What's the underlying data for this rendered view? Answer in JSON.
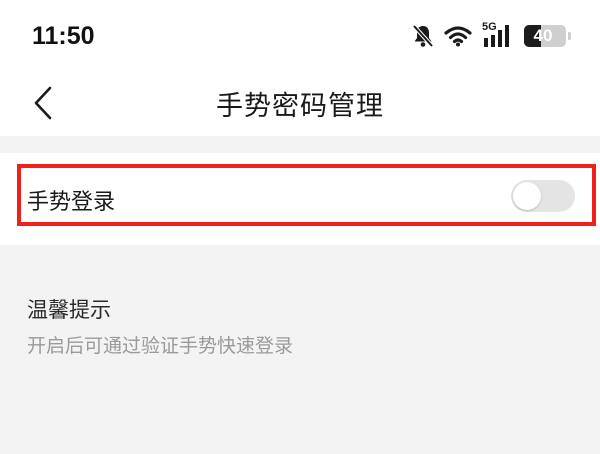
{
  "status_bar": {
    "time": "11:50",
    "network_label": "5G",
    "battery_level": "40",
    "battery_fraction": 0.4,
    "icons": [
      "bell-muted-icon",
      "wifi-icon",
      "signal-5g-icon",
      "battery-icon"
    ]
  },
  "nav": {
    "title": "手势密码管理",
    "back_icon": "back-chevron-icon"
  },
  "gesture_login": {
    "label": "手势登录",
    "enabled": false,
    "highlight_color": "#f0201a"
  },
  "tips": {
    "title": "温馨提示",
    "text": "开启后可通过验证手势快速登录"
  }
}
